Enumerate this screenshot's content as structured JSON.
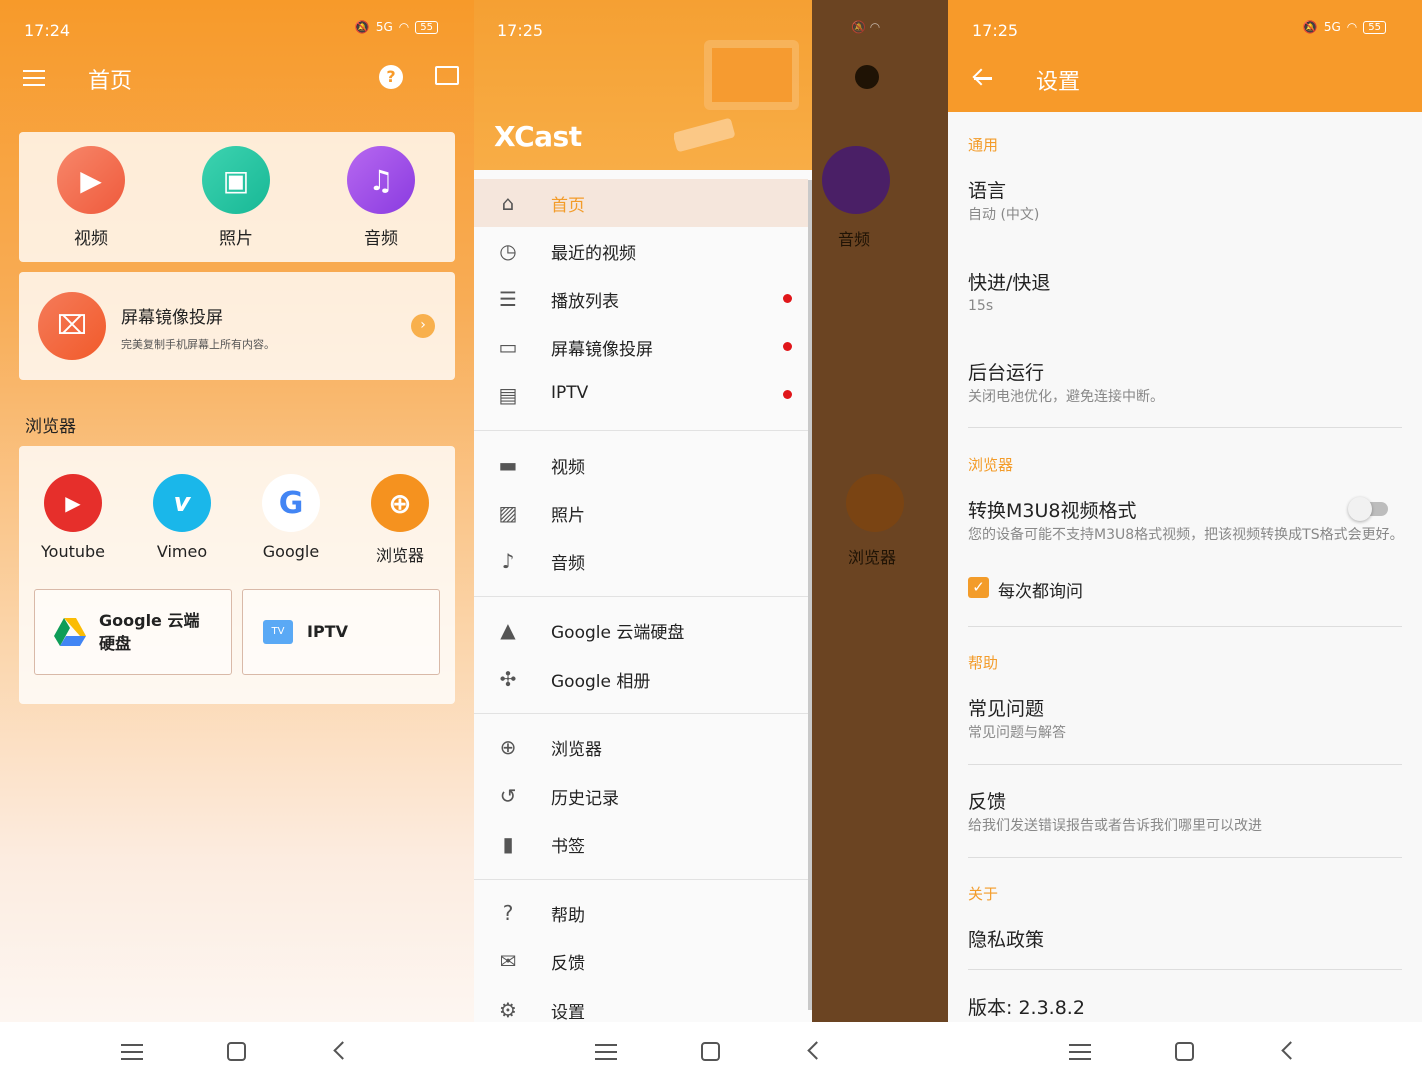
{
  "colors": {
    "accent": "#f79a2a",
    "red_dot": "#e0161a"
  },
  "status": {
    "time1": "17:24",
    "time2": "17:25",
    "time3": "17:25",
    "battery": "55",
    "network": "5G"
  },
  "home": {
    "title": "首页",
    "media": [
      {
        "label": "视频",
        "icon": "video-icon"
      },
      {
        "label": "照片",
        "icon": "photo-icon"
      },
      {
        "label": "音频",
        "icon": "music-icon"
      }
    ],
    "mirror": {
      "title": "屏幕镜像投屏",
      "subtitle": "完美复制手机屏幕上所有内容。"
    },
    "browser_section": "浏览器",
    "browsers": [
      {
        "label": "Youtube",
        "icon": "youtube-icon"
      },
      {
        "label": "Vimeo",
        "icon": "vimeo-icon"
      },
      {
        "label": "Google",
        "icon": "google-icon"
      },
      {
        "label": "浏览器",
        "icon": "globe-icon"
      }
    ],
    "boxes": {
      "drive": "Google 云端\n硬盘",
      "iptv": "IPTV"
    }
  },
  "drawer": {
    "logo": "XCast",
    "items": [
      {
        "label": "首页",
        "icon": "home-icon"
      },
      {
        "label": "最近的视频",
        "icon": "clock-icon"
      },
      {
        "label": "播放列表",
        "icon": "playlist-icon"
      },
      {
        "label": "屏幕镜像投屏",
        "icon": "mirror-icon"
      },
      {
        "label": "IPTV",
        "icon": "tv-icon"
      },
      {
        "label": "视频",
        "icon": "video-icon"
      },
      {
        "label": "照片",
        "icon": "photo-icon"
      },
      {
        "label": "音频",
        "icon": "music-icon"
      },
      {
        "label": "Google 云端硬盘",
        "icon": "drive-icon"
      },
      {
        "label": "Google 相册",
        "icon": "pinwheel-icon"
      },
      {
        "label": "浏览器",
        "icon": "globe-icon"
      },
      {
        "label": "历史记录",
        "icon": "history-icon"
      },
      {
        "label": "书签",
        "icon": "bookmark-icon"
      },
      {
        "label": "帮助",
        "icon": "help-icon"
      },
      {
        "label": "反馈",
        "icon": "feedback-icon"
      },
      {
        "label": "设置",
        "icon": "settings-icon"
      }
    ],
    "behind": {
      "audio": "音频",
      "browser": "浏览器"
    }
  },
  "settings": {
    "title": "设置",
    "cat_general": "通用",
    "language": {
      "title": "语言",
      "value": "自动 (中文)"
    },
    "seek": {
      "title": "快进/快退",
      "value": "15s"
    },
    "background": {
      "title": "后台运行",
      "value": "关闭电池优化，避免连接中断。"
    },
    "cat_browser": "浏览器",
    "m3u8": {
      "title": "转换M3U8视频格式",
      "value": "您的设备可能不支持M3U8格式视频，把该视频转换成TS格式会更好。",
      "toggle": "off"
    },
    "ask": {
      "label": "每次都询问",
      "checked": true
    },
    "cat_help": "帮助",
    "faq": {
      "title": "常见问题",
      "value": "常见问题与解答"
    },
    "feedback": {
      "title": "反馈",
      "value": "给我们发送错误报告或者告诉我们哪里可以改进"
    },
    "cat_about": "关于",
    "privacy": "隐私政策",
    "version": "版本: 2.3.8.2"
  }
}
